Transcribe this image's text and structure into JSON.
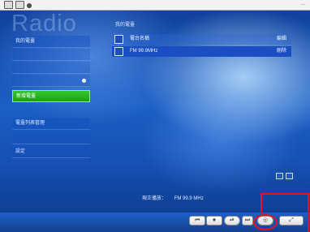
{
  "app": {
    "brand": "Radio"
  },
  "status_bar": {
    "indicator": "..."
  },
  "sidebar": {
    "items": [
      {
        "label": "我的電臺"
      },
      {
        "label": ""
      },
      {
        "label": ""
      },
      {
        "label": ""
      },
      {
        "label": "新增電臺",
        "active": true
      },
      {
        "label": "電臺列表管理"
      },
      {
        "label": ""
      },
      {
        "label": "設定"
      }
    ]
  },
  "main": {
    "title": "我的電臺",
    "stations": [
      {
        "name": "電台名稱",
        "value": "編輯",
        "selected": false
      },
      {
        "name": "FM 99.9MHz",
        "value": "刪除",
        "selected": true
      }
    ]
  },
  "footer": {
    "label": "現正播放：",
    "value": "FM 99.9 MHz"
  },
  "toolbar": {
    "controls": [
      {
        "label": "⏮"
      },
      {
        "label": "⏹"
      },
      {
        "label": "⏯"
      },
      {
        "label": "⏭"
      },
      {
        "label": "◎"
      },
      {
        "label": "⤢"
      }
    ]
  },
  "colors": {
    "accent": "#2fc02a",
    "annotation": "#e0141e",
    "background": "#1c5fc5"
  },
  "icons": [
    "window-icon",
    "record-icon",
    "checkbox-icon",
    "scroll-icon"
  ]
}
